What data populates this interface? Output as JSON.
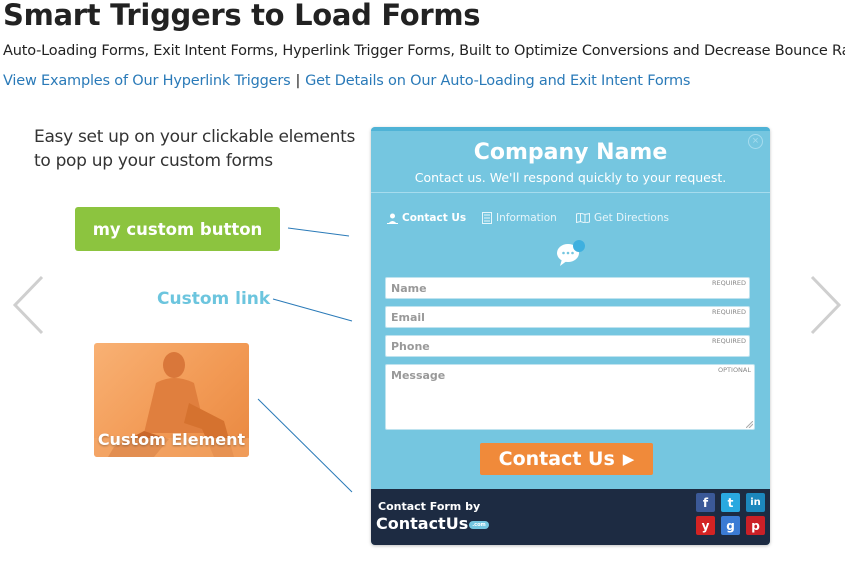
{
  "header": {
    "title": "Smart Triggers to Load Forms",
    "subtitle": "Auto-Loading Forms, Exit Intent Forms, Hyperlink Trigger Forms, Built to Optimize Conversions and Decrease Bounce Rates",
    "link1": "View Examples of Our Hyperlink Triggers",
    "separator": "|",
    "link2": "Get Details on Our Auto-Loading and Exit Intent Forms"
  },
  "demo": {
    "intro": "Easy set up on your clickable elements to pop up your custom forms",
    "button_label": "my custom button",
    "link_label": "Custom link",
    "element_label": "Custom Element"
  },
  "carousel": {
    "prev_icon": "chevron-left-icon",
    "next_icon": "chevron-right-icon"
  },
  "form": {
    "company": "Company Name",
    "tagline": "Contact us. We'll respond quickly to your request.",
    "tabs": [
      {
        "label": "Contact Us",
        "icon": "person-icon",
        "active": true
      },
      {
        "label": "Information",
        "icon": "document-icon",
        "active": false
      },
      {
        "label": "Get Directions",
        "icon": "map-icon",
        "active": false
      }
    ],
    "fields": [
      {
        "placeholder": "Name",
        "tag": "REQUIRED"
      },
      {
        "placeholder": "Email",
        "tag": "REQUIRED"
      },
      {
        "placeholder": "Phone",
        "tag": "REQUIRED"
      },
      {
        "placeholder": "Message",
        "tag": "OPTIONAL"
      }
    ],
    "submit_label": "Contact Us",
    "submit_arrow": "▶",
    "footer_by": "Contact Form by",
    "footer_brand": "ContactUs",
    "footer_brand_suffix": ".com",
    "social": [
      {
        "name": "facebook",
        "glyph": "f",
        "color": "#3b5998"
      },
      {
        "name": "twitter",
        "glyph": "t",
        "color": "#2aa9e0"
      },
      {
        "name": "linkedin",
        "glyph": "in",
        "color": "#1c87bd"
      },
      {
        "name": "yelp",
        "glyph": "y",
        "color": "#d32323"
      },
      {
        "name": "google",
        "glyph": "g",
        "color": "#3b7bd4"
      },
      {
        "name": "pinterest",
        "glyph": "p",
        "color": "#cb2027"
      }
    ]
  },
  "colors": {
    "accent_green": "#8cc43f",
    "link_blue": "#2a7ab8",
    "form_bg": "#75c6e0",
    "submit_orange": "#f08a3a",
    "footer_navy": "#1d2b42"
  }
}
